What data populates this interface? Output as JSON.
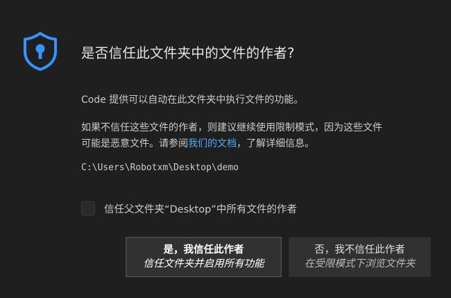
{
  "title": "是否信任此文件夹中的文件的作者?",
  "description": {
    "line1": "Code 提供可以自动在此文件夹中执行文件的功能。",
    "line2": "如果不信任这些文件的作者，则建议继续使用限制模式，因为这些文件",
    "line3_before_link": "可能是恶意文件。请参阅",
    "line3_link": "我们的文档",
    "line3_after_link": "，了解详细信息。"
  },
  "folder_path": "C:\\Users\\Robotxm\\Desktop\\demo",
  "checkbox": {
    "label": "信任父文件夹“Desktop”中所有文件的作者",
    "checked": false
  },
  "buttons": {
    "trust": {
      "label": "是，我信任此作者",
      "sublabel": "信任文件夹并启用所有功能"
    },
    "no_trust": {
      "label": "否，我不信任此作者",
      "sublabel": "在受限模式下浏览文件夹"
    }
  },
  "colors": {
    "background": "#1f1f1f",
    "accent": "#4daafc",
    "shield": "#3794ff"
  },
  "icons": {
    "shield": "shield-lock-icon"
  }
}
